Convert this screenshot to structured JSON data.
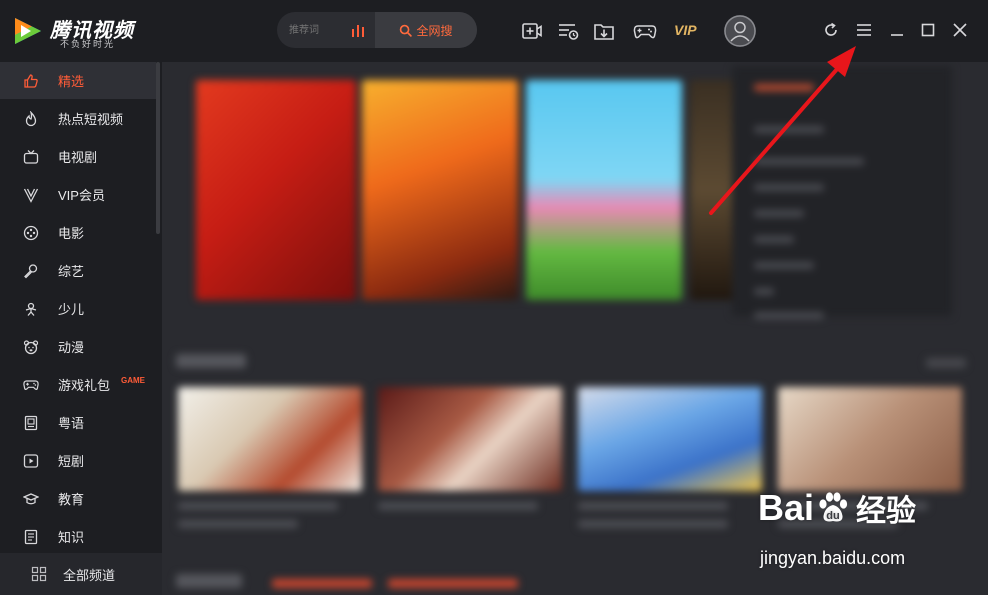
{
  "app": {
    "name": "腾讯视频",
    "slogan": "不负好时光"
  },
  "search": {
    "placeholder": "推荐词",
    "button_label": "全网搜"
  },
  "toolbar": {
    "icons": [
      "add-video-icon",
      "playlist-icon",
      "download-icon",
      "gamepad-icon"
    ],
    "vip_label": "VIP"
  },
  "window_controls": [
    "refresh-icon",
    "menu-icon",
    "minimize-icon",
    "maximize-icon",
    "close-icon"
  ],
  "sidebar": {
    "items": [
      {
        "label": "精选",
        "icon": "thumbs-up-icon",
        "active": true
      },
      {
        "label": "热点短视频",
        "icon": "flame-icon"
      },
      {
        "label": "电视剧",
        "icon": "tv-icon"
      },
      {
        "label": "VIP会员",
        "icon": "vip-v-icon"
      },
      {
        "label": "电影",
        "icon": "film-reel-icon"
      },
      {
        "label": "综艺",
        "icon": "microphone-icon"
      },
      {
        "label": "少儿",
        "icon": "kids-icon"
      },
      {
        "label": "动漫",
        "icon": "bear-face-icon"
      },
      {
        "label": "游戏礼包",
        "icon": "gamepad-icon",
        "tag": "GAME"
      },
      {
        "label": "粤语",
        "icon": "document-icon"
      },
      {
        "label": "短剧",
        "icon": "play-box-icon"
      },
      {
        "label": "教育",
        "icon": "graduation-cap-icon"
      },
      {
        "label": "知识",
        "icon": "book-icon"
      }
    ],
    "all_channels": "全部频道"
  },
  "watermark": {
    "brand": "Bai",
    "brand_cn": "经验",
    "url": "jingyan.baidu.com"
  },
  "colors": {
    "accent": "#ff5c38",
    "vip_gold": "#e2b563",
    "annotation_arrow": "#e8161b"
  }
}
